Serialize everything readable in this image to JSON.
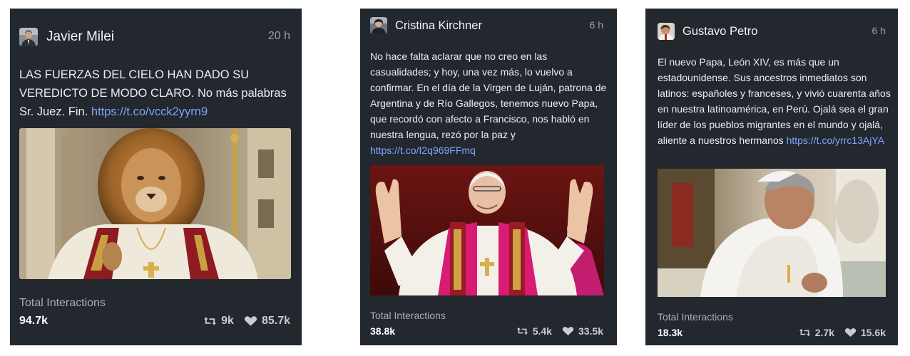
{
  "posts": [
    {
      "author": "Javier Milei",
      "time": "20 h",
      "text": "LAS FUERZAS DEL CIELO HAN DADO SU VEREDICTO DE MODO CLARO. No más palabras Sr. Juez. Fin.",
      "link": "https://t.co/vcck2yyrn9",
      "avatar_icon": "person-avatar-icon",
      "image": "lion-in-papal-robes-image",
      "stats": {
        "label": "Total Interactions",
        "total": "94.7k",
        "retweets": "9k",
        "likes": "85.7k"
      }
    },
    {
      "author": "Cristina Kirchner",
      "time": "6 h",
      "text": "No hace falta aclarar que no creo en las casualidades; y hoy, una vez más, lo vuelvo a confirmar. En el día de la Virgen de Luján, patrona de Argentina y de Río Gallegos, tenemos nuevo Papa, que recordó con afecto a Francisco, nos habló en nuestra lengua, rezó por la paz y",
      "link": "https://t.co/I2q969FFmq",
      "avatar_icon": "person-avatar-icon",
      "image": "pope-waving-balcony-image",
      "stats": {
        "label": "Total Interactions",
        "total": "38.8k",
        "retweets": "5.4k",
        "likes": "33.5k"
      }
    },
    {
      "author": "Gustavo Petro",
      "time": "6 h",
      "text": "El nuevo Papa, León XIV, es más que un estadounidense. Sus ancestros inmediatos son latinos: españoles y franceses, y vivió cuarenta años en nuestra latinoamérica, en Perú. Ojalá sea el gran líder de los pueblos migrantes en el mundo y ojalá, aliente a nuestros hermanos",
      "link": "https://t.co/yrrc13AjYA",
      "avatar_icon": "person-avatar-icon",
      "image": "cleric-in-white-robes-image",
      "stats": {
        "label": "Total Interactions",
        "total": "18.3k",
        "retweets": "2.7k",
        "likes": "15.6k"
      }
    }
  ],
  "icons": {
    "retweet": "retweet-icon",
    "like": "heart-icon"
  },
  "colors": {
    "card_background": "#23272e",
    "link": "#7da7ff",
    "muted_text": "#9aa0a8"
  }
}
